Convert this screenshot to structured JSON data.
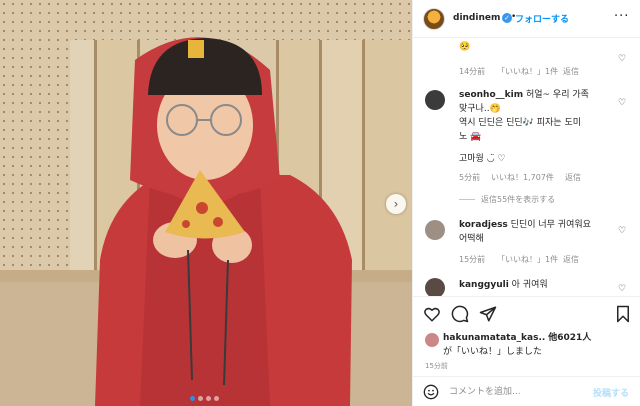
{
  "header": {
    "username": "dindinem",
    "follow_label": "フォローする",
    "more_icon": "more-icon"
  },
  "comments": [
    {
      "username": "",
      "text": "🥺",
      "time": "14分前",
      "likes": "「いいね！」1件",
      "reply": "返信"
    },
    {
      "username": "seonho__kim",
      "text_line1": "허얼~ 우리 가족",
      "text_line2": "맞구나..🤭",
      "text_line3": "역시 딘딘은 딘딘🎶 피자는 도미",
      "text_line4": "노 🚘",
      "text_line5": "고마웡 ◡̈ ♡",
      "time": "5分前",
      "likes": "いいね！1,707件",
      "reply": "返信",
      "view_replies": "返信55件を表示する"
    },
    {
      "username": "koradjess",
      "text_line1": "딘딘이 너무 귀여워요",
      "text_line2": "어떡해",
      "time": "15分前",
      "likes": "「いいね！」1件",
      "reply": "返信"
    },
    {
      "username": "kanggyuli",
      "text": "아 귀여워",
      "time": "",
      "likes": "",
      "reply": ""
    }
  ],
  "actions": {
    "like_icon": "heart-icon",
    "comment_icon": "comment-icon",
    "share_icon": "share-icon",
    "save_icon": "bookmark-icon"
  },
  "likes": {
    "user": "hakunamatata_kas..",
    "others": "他6021人",
    "suffix": "が「いいね！」しました"
  },
  "time_ago": "15分前",
  "add_comment": {
    "placeholder": "コメントを追加...",
    "post_label": "投稿する"
  },
  "carousel": {
    "count": 4,
    "active_index": 0
  },
  "colors": {
    "accent": "#0095f6",
    "verified": "#3897f0"
  }
}
